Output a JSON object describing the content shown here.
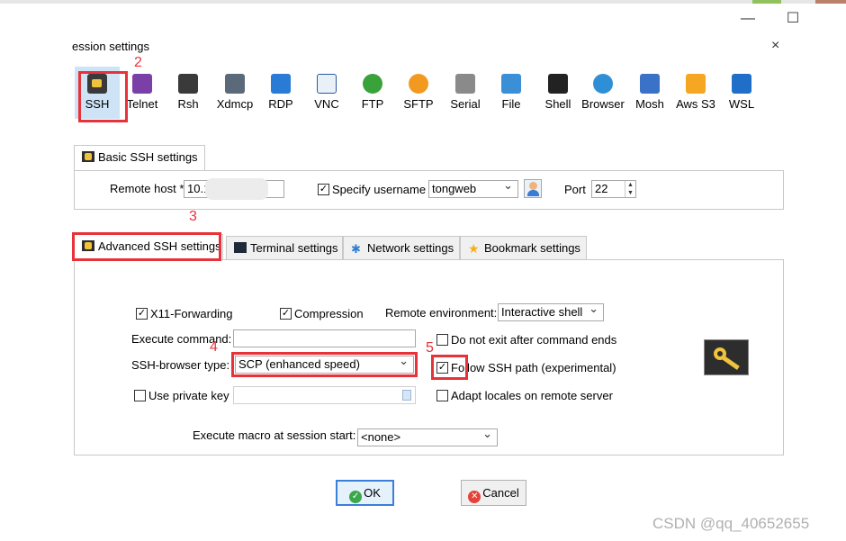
{
  "window": {
    "minimize_icon": "—",
    "maximize_icon": "☐"
  },
  "dialog": {
    "title": "ession settings",
    "close_icon": "×"
  },
  "session_types": [
    {
      "label": "SSH",
      "icon": "key-icon",
      "color": "#3a3a3a"
    },
    {
      "label": "Telnet",
      "icon": "telnet-icon",
      "color": "#7b3fa8"
    },
    {
      "label": "Rsh",
      "icon": "rsh-icon",
      "color": "#3a3a3a"
    },
    {
      "label": "Xdmcp",
      "icon": "xdmcp-icon",
      "color": "#5a6a7a"
    },
    {
      "label": "RDP",
      "icon": "rdp-icon",
      "color": "#2a7bd6"
    },
    {
      "label": "VNC",
      "icon": "vnc-icon",
      "color": "#e8f0f8"
    },
    {
      "label": "FTP",
      "icon": "ftp-icon",
      "color": "#3aa23a"
    },
    {
      "label": "SFTP",
      "icon": "sftp-icon",
      "color": "#f29a1f"
    },
    {
      "label": "Serial",
      "icon": "serial-icon",
      "color": "#8a8a8a"
    },
    {
      "label": "File",
      "icon": "file-icon",
      "color": "#3a8fd6"
    },
    {
      "label": "Shell",
      "icon": "shell-icon",
      "color": "#222222"
    },
    {
      "label": "Browser",
      "icon": "browser-icon",
      "color": "#2f8fd6"
    },
    {
      "label": "Mosh",
      "icon": "mosh-icon",
      "color": "#3a72c8"
    },
    {
      "label": "Aws S3",
      "icon": "aws-s3-icon",
      "color": "#f5a623"
    },
    {
      "label": "WSL",
      "icon": "wsl-icon",
      "color": "#1f6fc8"
    }
  ],
  "annotations": {
    "n2": "2",
    "n3": "3",
    "n4": "4",
    "n5": "5"
  },
  "basic": {
    "tab": "Basic SSH settings",
    "remote_host_label": "Remote host *",
    "remote_host_value": "10.1",
    "specify_username_label": "Specify username",
    "specify_username_checked": true,
    "username_value": "tongweb",
    "port_label": "Port",
    "port_value": "22"
  },
  "tabs": [
    {
      "label": "Advanced SSH settings",
      "icon": "key-icon"
    },
    {
      "label": "Terminal settings",
      "icon": "terminal-icon"
    },
    {
      "label": "Network settings",
      "icon": "network-icon"
    },
    {
      "label": "Bookmark settings",
      "icon": "star-icon"
    }
  ],
  "advanced": {
    "x11_label": "X11-Forwarding",
    "x11_checked": true,
    "compression_label": "Compression",
    "compression_checked": true,
    "remote_env_label": "Remote environment:",
    "remote_env_value": "Interactive shell",
    "exec_cmd_label": "Execute command:",
    "exec_cmd_value": "",
    "no_exit_label": "Do not exit after command ends",
    "no_exit_checked": false,
    "browser_type_label": "SSH-browser type:",
    "browser_type_value": "SCP (enhanced speed)",
    "follow_path_label": "Follow SSH path (experimental)",
    "follow_path_checked": true,
    "private_key_label": "Use private key",
    "private_key_checked": false,
    "adapt_locales_label": "Adapt locales on remote server",
    "adapt_locales_checked": false,
    "macro_label": "Execute macro at session start:",
    "macro_value": "<none>"
  },
  "buttons": {
    "ok": "OK",
    "cancel": "Cancel"
  },
  "watermark": "CSDN @qq_40652655"
}
